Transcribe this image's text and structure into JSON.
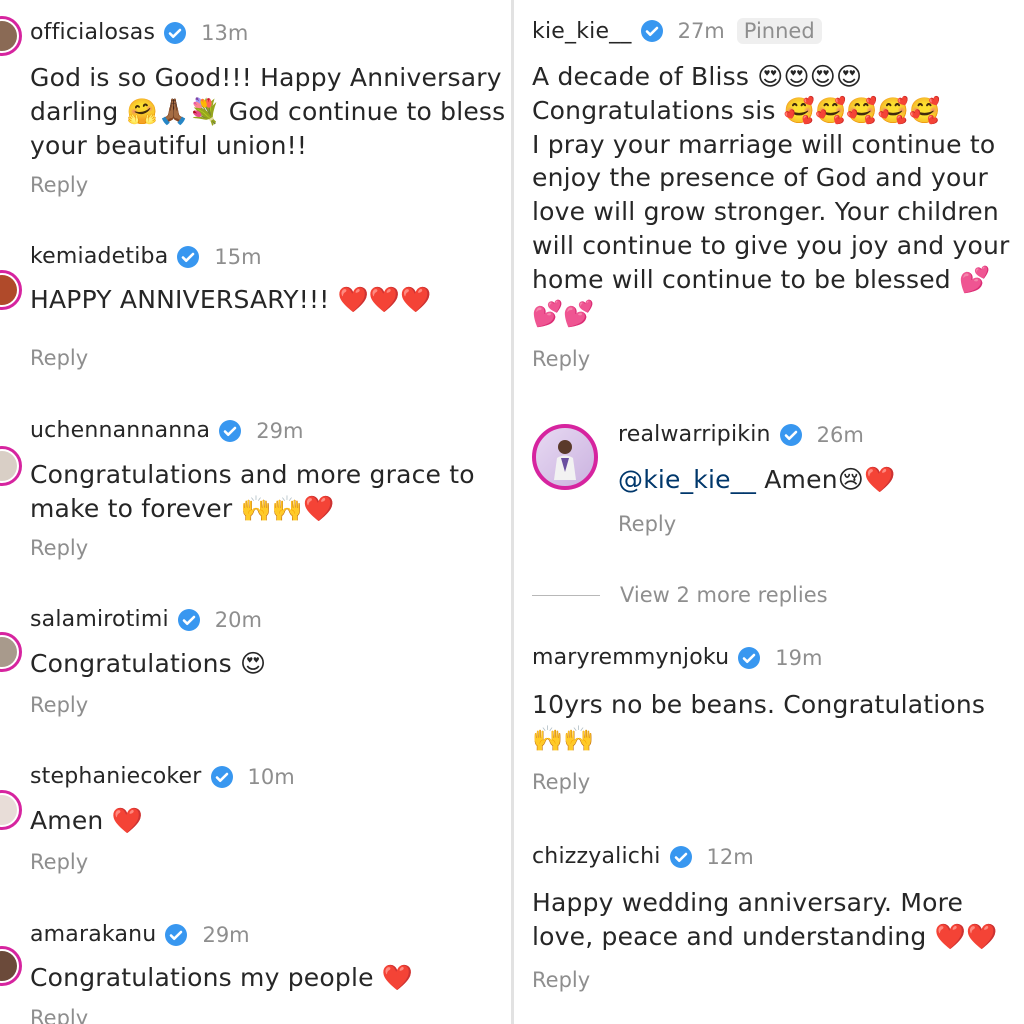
{
  "left": [
    {
      "username": "officialosas",
      "time": "13m",
      "text": "God is so Good!!! Happy Anniversary\ndarling 🤗🙏🏾💐 God continue to bless\nyour beautiful union!!",
      "reply": "Reply"
    },
    {
      "username": "kemiadetiba",
      "time": "15m",
      "text": "HAPPY ANNIVERSARY!!! ❤️❤️❤️",
      "reply": "Reply"
    },
    {
      "username": "uchennannanna",
      "time": "29m",
      "text": "Congratulations and more grace to\nmake to forever 🙌🙌❤️",
      "reply": "Reply"
    },
    {
      "username": "salamirotimi",
      "time": "20m",
      "text": "Congratulations 😍",
      "reply": "Reply"
    },
    {
      "username": "stephaniecoker",
      "time": "10m",
      "text": "Amen ❤️",
      "reply": "Reply"
    },
    {
      "username": "amarakanu",
      "time": "29m",
      "text": "Congratulations my people ❤️",
      "reply": "Reply"
    }
  ],
  "right": {
    "pinned_comment": {
      "username": "kie_kie__",
      "time": "27m",
      "badge": "Pinned",
      "text": "A decade of Bliss 😍😍😍😍\nCongratulations sis 🥰🥰🥰🥰🥰\nI pray your marriage will continue to\nenjoy the presence of God and your\nlove will grow stronger. Your children\nwill continue to give you joy and your\nhome will continue to be blessed 💕\n💕💕",
      "reply": "Reply"
    },
    "reply_comment": {
      "username": "realwarripikin",
      "time": "26m",
      "mention": "@kie_kie__",
      "text": " Amen😢❤️",
      "reply": "Reply"
    },
    "view_more": "View 2 more replies",
    "comments": [
      {
        "username": "maryremmynjoku",
        "time": "19m",
        "text": "10yrs no be beans. Congratulations\n🙌🙌",
        "reply": "Reply"
      },
      {
        "username": "chizzyalichi",
        "time": "12m",
        "text": "Happy wedding anniversary. More\nlove, peace and understanding ❤️❤️",
        "reply": "Reply"
      }
    ]
  },
  "colors": {
    "verified": "#3897f0",
    "avatar_ring": "#d6249f",
    "secondary_text": "#8e8e8e",
    "mention": "#00376b"
  }
}
